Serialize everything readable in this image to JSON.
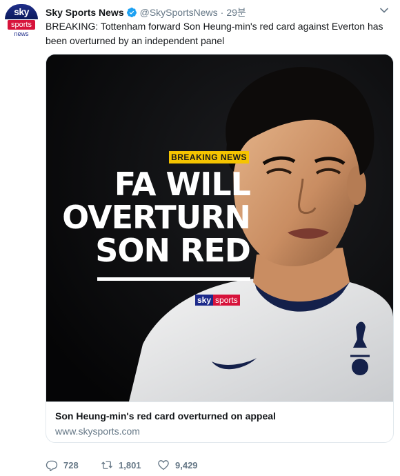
{
  "account": {
    "name": "Sky Sports News",
    "handle": "@SkySportsNews",
    "separator": "·",
    "time": "29분",
    "avatar": {
      "line1": "sky",
      "line2": "sports",
      "line3": "news"
    }
  },
  "tweet": {
    "text": "BREAKING: Tottenham forward Son Heung-min's red card against Everton has been overturned by an independent panel"
  },
  "card": {
    "image": {
      "badge": "BREAKING NEWS",
      "headline_lines": [
        "FA WILL",
        "OVERTURN",
        "SON RED"
      ],
      "logo_sky": "sky",
      "logo_sports": "sports"
    },
    "title": "Son Heung-min's red card overturned on appeal",
    "domain": "www.skysports.com"
  },
  "actions": {
    "reply_count": "728",
    "retweet_count": "1,801",
    "like_count": "9,429"
  },
  "colors": {
    "verified": "#1da1f2",
    "sky_blue": "#1c2a8a",
    "sky_red": "#d7133b",
    "badge_yellow": "#f5c400",
    "muted_text": "#657786"
  }
}
